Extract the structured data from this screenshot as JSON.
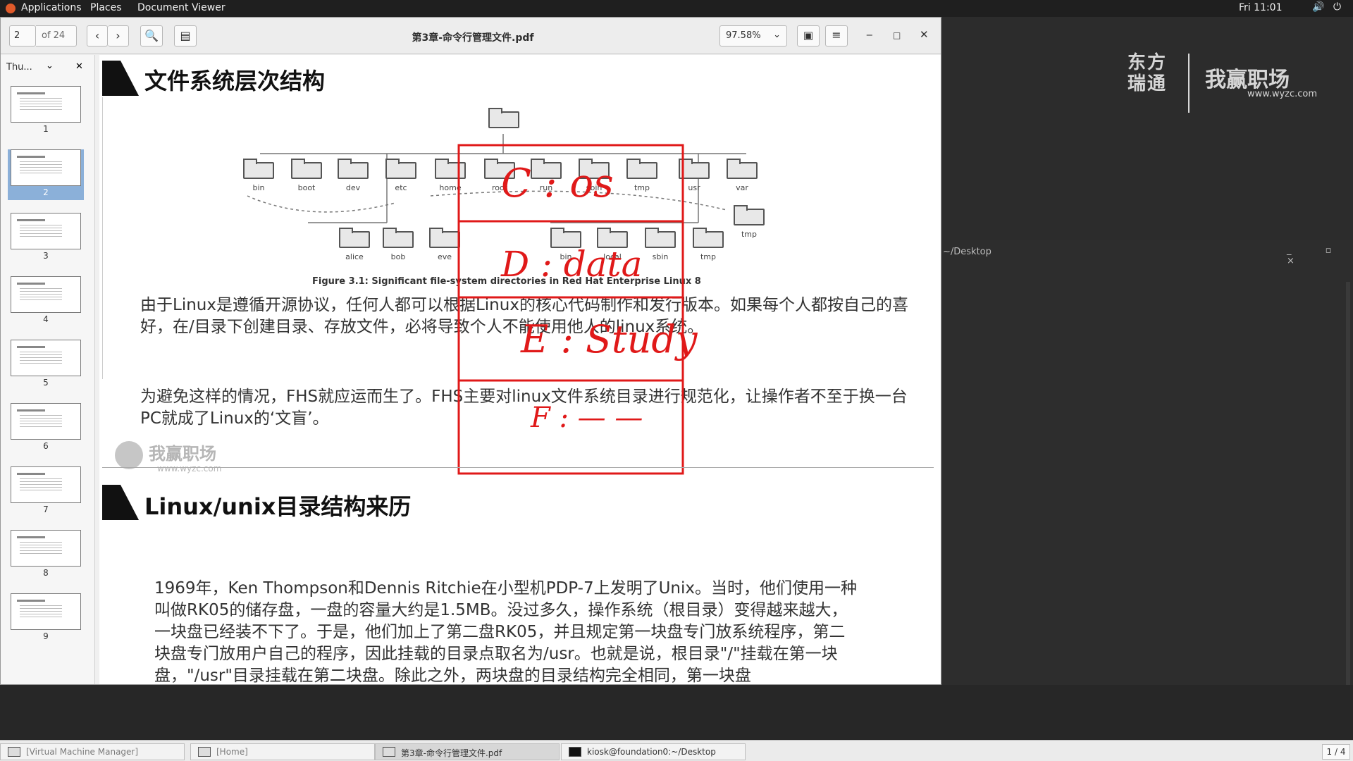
{
  "topbar": {
    "applications": "Applications",
    "places": "Places",
    "document_viewer": "Document Viewer",
    "clock": "Fri 11:01",
    "volume_icon": "🔊",
    "power_icon": "⏻"
  },
  "desktop": {
    "logo_dongfang": "东方\n瑞通",
    "logo_wy": "我赢职场",
    "logo_url": "www.wyzc.com",
    "terminal_title": "~/Desktop",
    "terminal_controls": "_ ▫ ×"
  },
  "viewer": {
    "page_current": "2",
    "page_total": "of 24",
    "prev": "‹",
    "next": "›",
    "search_icon": "🔍",
    "annot_icon": "▤",
    "title": "第3章-命令行管理文件.pdf",
    "zoom": "97.58%",
    "zoom_arrow": "⌄",
    "view_icon": "▣",
    "menu_icon": "≡",
    "min": "‒",
    "max": "□",
    "close": "✕"
  },
  "sidebar": {
    "mode": "Thu...",
    "mode_arrow": "⌄",
    "close": "✕",
    "thumbs": [
      "1",
      "2",
      "3",
      "4",
      "5",
      "6",
      "7",
      "8",
      "9"
    ],
    "selected": "2"
  },
  "slide1": {
    "title": "文件系统层次结构",
    "folders_top": [
      "bin",
      "boot",
      "dev",
      "etc",
      "home",
      "root",
      "run",
      "sbin",
      "tmp",
      "usr",
      "var"
    ],
    "folders_bottom": [
      "alice",
      "bob",
      "eve",
      "bin",
      "local",
      "sbin",
      "tmp",
      "tmp"
    ],
    "caption": "Figure 3.1: Significant file-system directories in Red Hat Enterprise Linux 8",
    "para1": "由于Linux是遵循开源协议，任何人都可以根据Linux的核心代码制作和发行版本。如果每个人都按自己的喜好，在/目录下创建目录、存放文件，必将导致个人不能使用他人的linux系统。",
    "para2": "为避免这样的情况，FHS就应运而生了。FHS主要对linux文件系统目录进行规范化，让操作者不至于换一台PC就成了Linux的‘文盲’。",
    "wm_text": "我赢职场",
    "wm_url": "www.wyzc.com"
  },
  "annotations": {
    "c": "C : os",
    "d": "D : data",
    "e": "E : Study",
    "f": "F : — —",
    "color": "#e01919"
  },
  "slide2": {
    "title": "Linux/unix目录结构来历",
    "para": "1969年，Ken Thompson和Dennis Ritchie在小型机PDP-7上发明了Unix。当时，他们使用一种叫做RK05的储存盘，一盘的容量大约是1.5MB。没过多久，操作系统（根目录）变得越来越大，一块盘已经装不下了。于是，他们加上了第二盘RK05，并且规定第一块盘专门放系统程序，第二块盘专门放用户自己的程序，因此挂载的目录点取名为/usr。也就是说，根目录\"/\"挂载在第一块盘，\"/usr\"目录挂载在第二块盘。除此之外，两块盘的目录结构完全相同，第一块盘"
  },
  "taskbar": {
    "t1": "[Virtual Machine Manager]",
    "t2": "[Home]",
    "t3": "第3章-命令行管理文件.pdf",
    "t4": "kiosk@foundation0:~/Desktop",
    "workspace": "1 / 4"
  }
}
